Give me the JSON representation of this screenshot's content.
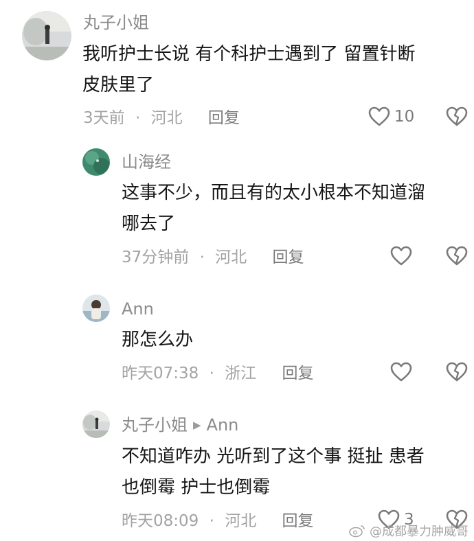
{
  "comments": [
    {
      "author": "丸子小姐",
      "text_lines": [
        "我听护士长说 有个科护士遇到了 留置针断",
        "皮肤里了"
      ],
      "time": "3天前",
      "location": "河北",
      "reply_label": "回复",
      "likes": "10"
    },
    {
      "author": "山海经",
      "text_lines": [
        "这事不少，而且有的太小根本不知道溜",
        "哪去了"
      ],
      "time": "37分钟前",
      "location": "河北",
      "reply_label": "回复",
      "likes": ""
    },
    {
      "author": "Ann",
      "text_lines": [
        "那怎么办"
      ],
      "time": "昨天07:38",
      "location": "浙江",
      "reply_label": "回复",
      "likes": ""
    },
    {
      "author": "丸子小姐",
      "reply_to": "Ann",
      "text_lines": [
        "不知道咋办 光听到了这个事 挺扯 患者",
        "也倒霉 护士也倒霉"
      ],
      "time": "昨天08:09",
      "location": "河北",
      "reply_label": "回复",
      "likes": "3"
    }
  ],
  "meta_separator": "·",
  "watermark": "@成都暴力肿威哥",
  "colors": {
    "text": "#161616",
    "name": "#8b8b8b",
    "meta": "#a3a3a3",
    "icon": "#7a7a7a"
  }
}
